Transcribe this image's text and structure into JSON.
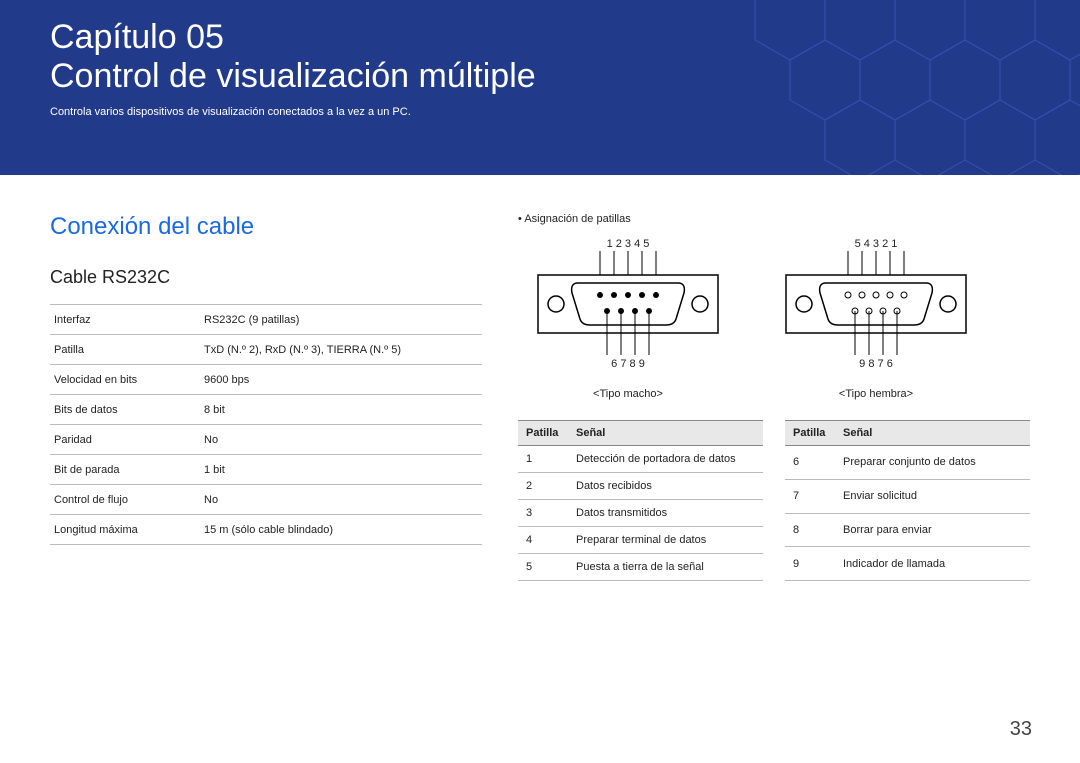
{
  "banner": {
    "chapter": "Capítulo 05",
    "title": "Control de visualización múltiple",
    "subtitle": "Controla varios dispositivos de visualización conectados a la vez a un PC."
  },
  "section_title": "Conexión del cable",
  "subsection_title": "Cable RS232C",
  "spec_rows": [
    {
      "k": "Interfaz",
      "v": "RS232C (9 patillas)"
    },
    {
      "k": "Patilla",
      "v": "TxD (N.º 2), RxD (N.º 3), TIERRA (N.º 5)"
    },
    {
      "k": "Velocidad en bits",
      "v": "9600 bps"
    },
    {
      "k": "Bits de datos",
      "v": "8 bit"
    },
    {
      "k": "Paridad",
      "v": "No"
    },
    {
      "k": "Bit de parada",
      "v": "1 bit"
    },
    {
      "k": "Control de flujo",
      "v": "No"
    },
    {
      "k": "Longitud máxima",
      "v": "15 m (sólo cable blindado)"
    }
  ],
  "right": {
    "bullet": "Asignación de patillas",
    "diagram_left": {
      "top_nums": "1 2 3 4 5",
      "bottom_nums": "6 7 8 9",
      "caption": "<Tipo macho>"
    },
    "diagram_right": {
      "top_nums": "5 4 3 2 1",
      "bottom_nums": "9 8 7 6",
      "caption": "<Tipo hembra>"
    },
    "pin_header1": "Patilla",
    "pin_header2": "Señal",
    "pins_left": [
      {
        "n": "1",
        "s": "Detección de portadora de datos"
      },
      {
        "n": "2",
        "s": "Datos recibidos"
      },
      {
        "n": "3",
        "s": "Datos transmitidos"
      },
      {
        "n": "4",
        "s": "Preparar terminal de datos"
      },
      {
        "n": "5",
        "s": "Puesta a tierra de la señal"
      }
    ],
    "pins_right": [
      {
        "n": "6",
        "s": "Preparar conjunto de datos"
      },
      {
        "n": "7",
        "s": "Enviar solicitud"
      },
      {
        "n": "8",
        "s": "Borrar para enviar"
      },
      {
        "n": "9",
        "s": "Indicador de llamada"
      }
    ]
  },
  "page_number": "33"
}
